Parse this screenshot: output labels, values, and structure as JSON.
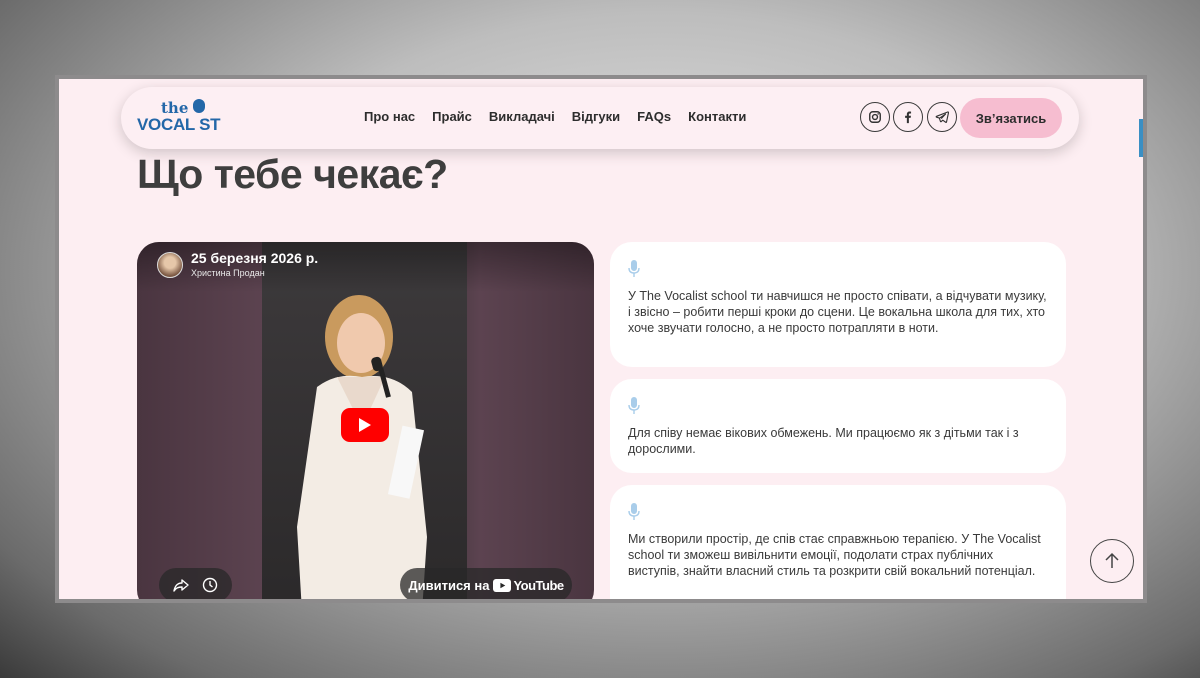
{
  "logo": {
    "line1": "the",
    "line2": "VOCAL ST"
  },
  "nav": [
    "Про нас",
    "Прайс",
    "Викладачі",
    "Відгуки",
    "FAQs",
    "Контакти"
  ],
  "social": [
    "instagram-icon",
    "facebook-icon",
    "telegram-icon"
  ],
  "cta_label": "Зв’язатись",
  "heading": "Що тебе чекає?",
  "video": {
    "title": "25 березня 2026 р.",
    "author": "Христина Продан",
    "watch_label": "Дивитися на",
    "youtube_label": "YouTube"
  },
  "cards": [
    {
      "text": "У The Vocalist school ти навчишся не просто співати, а відчувати музику, і звісно – робити перші кроки до сцени. Це вокальна школа для тих, хто хоче звучати голосно, а не просто потрапляти в ноти."
    },
    {
      "text": "Для співу немає вікових обмежень. Ми працюємо як з дітьми так і з дорослими."
    },
    {
      "text": "Ми створили простір, де спів стає справжньою терапією. У The Vocalist school ти зможеш вивільнити емоції, подолати страх публічних виступів, знайти власний стиль та розкрити свій вокальний потенціал."
    }
  ],
  "colors": {
    "page_bg": "#fdeef2",
    "brand": "#2367a8",
    "cta": "#f6bdd0",
    "mic_icon": "#a9cdea"
  }
}
